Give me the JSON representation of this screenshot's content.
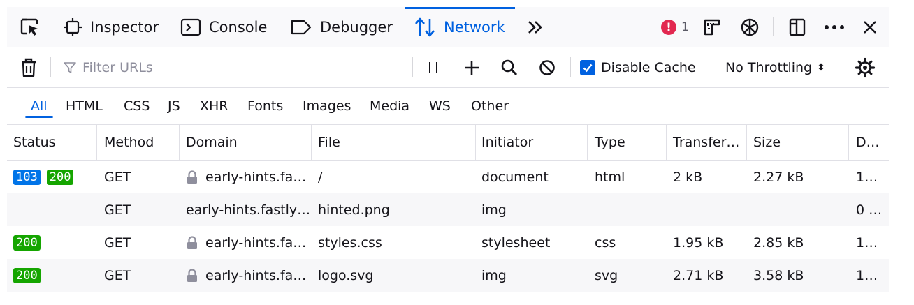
{
  "toolbar": {
    "tabs": [
      {
        "label": "Inspector"
      },
      {
        "label": "Console"
      },
      {
        "label": "Debugger"
      },
      {
        "label": "Network"
      }
    ],
    "error_count": "1",
    "active_color": "#0061e0",
    "error_color": "#e22850"
  },
  "network_toolbar": {
    "filter_placeholder": "Filter URLs",
    "disable_cache_label": "Disable Cache",
    "disable_cache_checked": true,
    "throttling_value": "No Throttling"
  },
  "type_filters": [
    {
      "label": "All",
      "active": true
    },
    {
      "label": "HTML"
    },
    {
      "label": "CSS"
    },
    {
      "label": "JS"
    },
    {
      "label": "XHR"
    },
    {
      "label": "Fonts"
    },
    {
      "label": "Images"
    },
    {
      "label": "Media"
    },
    {
      "label": "WS"
    },
    {
      "label": "Other"
    }
  ],
  "table": {
    "columns": [
      "Status",
      "Method",
      "Domain",
      "File",
      "Initiator",
      "Type",
      "Transfer…",
      "Size",
      "D…"
    ],
    "rows": [
      {
        "status": [
          "103",
          "200"
        ],
        "method": "GET",
        "domain": "early-hints.fa…",
        "secure": true,
        "file": "/",
        "initiator": "document",
        "type": "html",
        "transferred": "2 kB",
        "size": "2.27 kB",
        "duration": "1…"
      },
      {
        "status": [],
        "method": "GET",
        "domain": "early-hints.fastly…",
        "secure": false,
        "file": "hinted.png",
        "initiator": "img",
        "type": "",
        "transferred": "",
        "size": "",
        "duration": "0 …"
      },
      {
        "status": [
          "200"
        ],
        "method": "GET",
        "domain": "early-hints.fa…",
        "secure": true,
        "file": "styles.css",
        "initiator": "stylesheet",
        "type": "css",
        "transferred": "1.95 kB",
        "size": "2.85 kB",
        "duration": "1…"
      },
      {
        "status": [
          "200"
        ],
        "method": "GET",
        "domain": "early-hints.fa…",
        "secure": true,
        "file": "logo.svg",
        "initiator": "img",
        "type": "svg",
        "transferred": "2.71 kB",
        "size": "3.58 kB",
        "duration": "1…"
      }
    ]
  }
}
